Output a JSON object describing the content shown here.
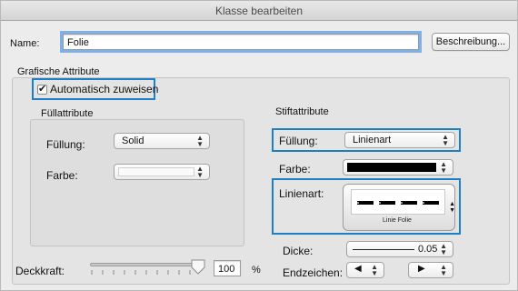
{
  "window": {
    "title": "Klasse bearbeiten"
  },
  "name_row": {
    "label": "Name:",
    "value": "Folie",
    "description_button": "Beschreibung..."
  },
  "graphics": {
    "title": "Grafische Attribute",
    "auto_assign": {
      "label": "Automatisch zuweisen",
      "checked": true
    }
  },
  "fill": {
    "title": "Füllattribute",
    "fill_label": "Füllung:",
    "fill_value": "Solid",
    "color_label": "Farbe:",
    "opacity_label": "Deckkraft:",
    "opacity_value": "100",
    "opacity_unit": "%",
    "opacity_fraction": 1.0
  },
  "pen": {
    "title": "Stiftattribute",
    "fill_label": "Füllung:",
    "fill_value": "Linienart",
    "color_label": "Farbe:",
    "color_value": "#000000",
    "linetype_label": "Linienart:",
    "linetype_name": "Linie Folie",
    "thickness_label": "Dicke:",
    "thickness_value": "0.05",
    "endmarks_label": "Endzeichen:",
    "endmark_start_glyph": "◀",
    "endmark_end_glyph": "▶"
  },
  "colors": {
    "highlight": "#1d7fc6",
    "focus": "#7fb0e6"
  }
}
